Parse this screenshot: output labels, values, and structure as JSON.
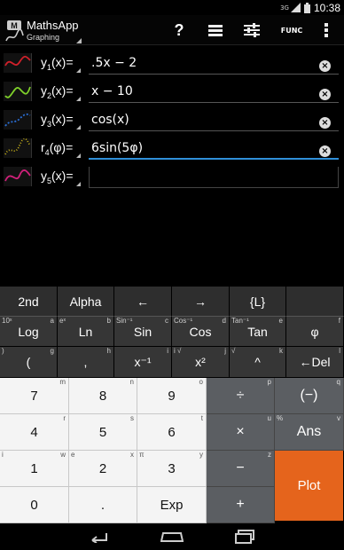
{
  "status_bar": {
    "time": "10:38",
    "network": "3G"
  },
  "action_bar": {
    "app_name": "MathsApp",
    "mode": "Graphing",
    "help_label": "?",
    "func_label": "FUNC"
  },
  "functions": [
    {
      "name": "y",
      "index": "1",
      "suffix": "(x)=",
      "expression": ".5x − 2",
      "color": "#d0202a",
      "active": false
    },
    {
      "name": "y",
      "index": "2",
      "suffix": "(x)=",
      "expression": "x − 10",
      "color": "#7fd12a",
      "active": false
    },
    {
      "name": "y",
      "index": "3",
      "suffix": "(x)=",
      "expression": "cos(x)",
      "color": "#2a6fd6",
      "active": false
    },
    {
      "name": "r",
      "index": "4",
      "suffix": "(φ)=",
      "expression": "6sin(5φ)",
      "color": "#c9b21a",
      "active": true
    },
    {
      "name": "y",
      "index": "5",
      "suffix": "(x)=",
      "expression": "",
      "color": "#d0207a",
      "active": false
    }
  ],
  "keys": {
    "row1": [
      "2nd",
      "Alpha",
      "←",
      "→",
      "{L}",
      ""
    ],
    "row2": [
      {
        "main": "Log",
        "tl": "10ˣ",
        "tr": "a"
      },
      {
        "main": "Ln",
        "tl": "eˣ",
        "tr": "b"
      },
      {
        "main": "Sin",
        "tl": "Sin⁻¹",
        "tr": "c"
      },
      {
        "main": "Cos",
        "tl": "Cos⁻¹",
        "tr": "d"
      },
      {
        "main": "Tan",
        "tl": "Tan⁻¹",
        "tr": "e"
      },
      {
        "main": "φ",
        "tl": "",
        "tr": "f"
      }
    ],
    "row3": [
      {
        "main": "(",
        "tl": ")",
        "tr": "g"
      },
      {
        "main": ",",
        "tl": "",
        "tr": "h"
      },
      {
        "main": "x⁻¹",
        "tl": "",
        "tr": "i"
      },
      {
        "main": "x²",
        "tl": "i √",
        "tr": "j"
      },
      {
        "main": "^",
        "tl": "√",
        "tr": "k"
      },
      {
        "main": "←Del",
        "tl": "",
        "tr": "l"
      }
    ],
    "num": [
      [
        {
          "main": "7",
          "tl": "",
          "tr": "m"
        },
        {
          "main": "8",
          "tl": "",
          "tr": "n"
        },
        {
          "main": "9",
          "tl": "",
          "tr": "o"
        },
        {
          "main": "÷",
          "tl": "",
          "tr": "p"
        },
        {
          "main": "(−)",
          "tl": "",
          "tr": "q"
        }
      ],
      [
        {
          "main": "4",
          "tl": "",
          "tr": "r"
        },
        {
          "main": "5",
          "tl": "",
          "tr": "s"
        },
        {
          "main": "6",
          "tl": "",
          "tr": "t"
        },
        {
          "main": "×",
          "tl": "",
          "tr": "u"
        },
        {
          "main": "Ans",
          "tl": "%",
          "tr": "v"
        }
      ],
      [
        {
          "main": "1",
          "tl": "i",
          "tr": "w"
        },
        {
          "main": "2",
          "tl": "e",
          "tr": "x"
        },
        {
          "main": "3",
          "tl": "π",
          "tr": "y"
        },
        {
          "main": "−",
          "tl": "",
          "tr": "z"
        }
      ],
      [
        {
          "main": "0",
          "tl": "",
          "tr": ""
        },
        {
          "main": ".",
          "tl": "",
          "tr": ""
        },
        {
          "main": "Exp",
          "tl": "",
          "tr": ""
        },
        {
          "main": "+",
          "tl": "",
          "tr": ""
        }
      ]
    ],
    "plot_label": "Plot"
  }
}
